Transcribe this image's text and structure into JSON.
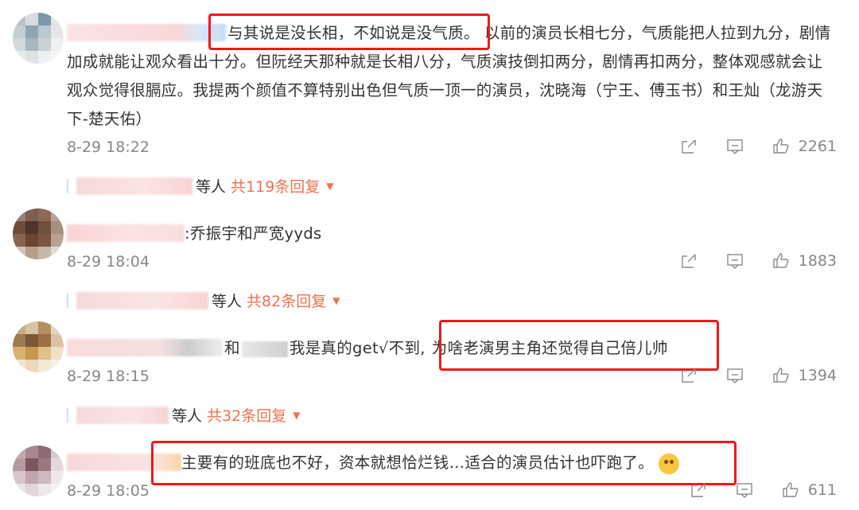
{
  "comments": [
    {
      "text_highlight": "与其说是没长相，不如说是没气质。",
      "text_line1_rest": "以前的演员长相七分，气质能把人拉到九分，",
      "text_rest": "剧情加成就能让观众看出十分。但阮经天那种就是长相八分，气质演技倒扣两分，剧情再扣两分，整体观感就会让观众觉得很膈应。我提两个颜值不算特别出色但气质一顶一的演员，沈晓海（宁王、傅玉书）和王灿（龙游天下-楚天佑）",
      "time": "8-29 18:22",
      "likes": "2261",
      "reply_prefix": "等人",
      "reply_count": "共119条回复"
    },
    {
      "text": ":乔振宇和严宽yyds",
      "time": "8-29 18:04",
      "likes": "1883",
      "reply_prefix": "等人",
      "reply_count": "共82条回复"
    },
    {
      "text_pre": "和",
      "text_mid": "我是真的get√不到,",
      "text_highlight": "为啥老演男主角还觉得自己倍儿帅",
      "time": "8-29 18:15",
      "likes": "1394",
      "reply_prefix": "等人",
      "reply_count": "共32条回复"
    },
    {
      "text": "主要有的班底也不好，资本就想恰烂钱…适合的演员估计也吓跑了。",
      "time": "8-29 18:05",
      "likes": "611"
    }
  ],
  "icons": {
    "share": "share-icon",
    "comment": "comment-icon",
    "like": "like-icon",
    "expand": "caret-down-icon"
  },
  "colors": {
    "accent": "#eb7350",
    "highlight_border": "#f01818",
    "muted": "#888888"
  }
}
